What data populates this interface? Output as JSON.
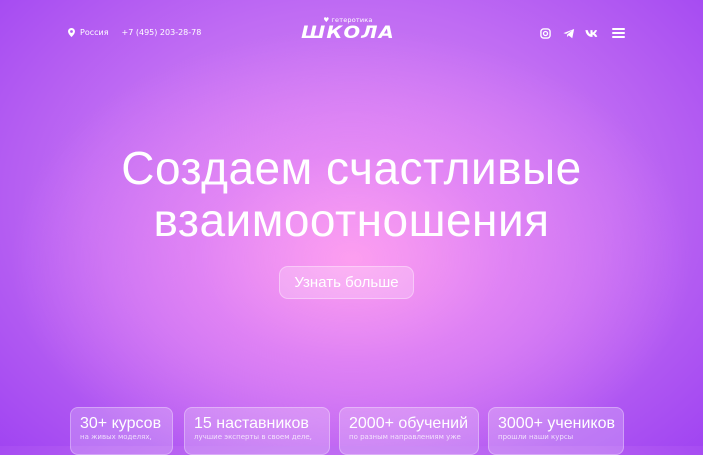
{
  "header": {
    "location": "Россия",
    "phone": "+7 (495) 203-28-78",
    "logo_small": "гетеротика",
    "logo_big": "ШКОЛА",
    "icons": [
      "instagram-icon",
      "telegram-icon",
      "vk-icon"
    ],
    "menu_icon": "menu-icon"
  },
  "hero": {
    "line1": "Создаем счастливые",
    "line2": "взаимоотношения",
    "cta": "Узнать больше"
  },
  "stats": [
    {
      "title": "30+ курсов",
      "subtitle": "на живых моделях,"
    },
    {
      "title": "15 наставников",
      "subtitle": "лучшие эксперты в своем деле,"
    },
    {
      "title": "2000+ обучений",
      "subtitle": "по разным направлениям уже"
    },
    {
      "title": "3000+ учеников",
      "subtitle": "прошли наши курсы"
    }
  ]
}
